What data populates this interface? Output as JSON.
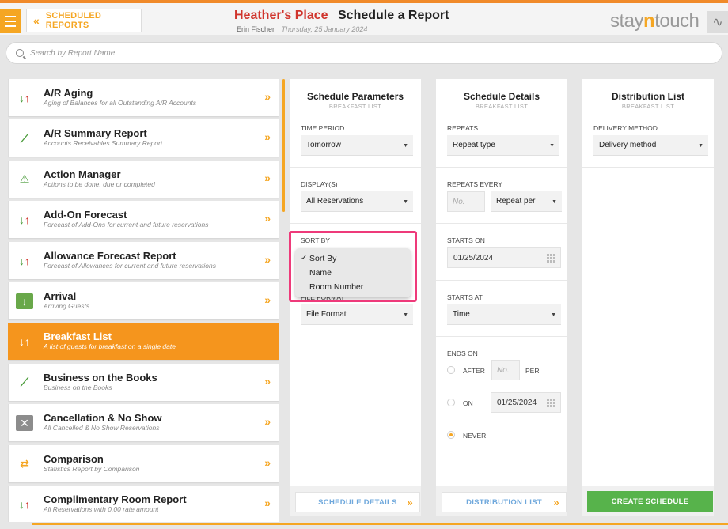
{
  "header": {
    "back_label": "SCHEDULED REPORTS",
    "hotel_name": "Heather's Place",
    "page_title": "Schedule a Report",
    "user": "Erin Fischer",
    "date": "Thursday, 25 January 2024",
    "logo_prefix": "stay",
    "logo_accent": "n",
    "logo_suffix": "touch"
  },
  "search": {
    "placeholder": "Search by Report Name"
  },
  "reports": [
    {
      "title": "A/R Aging",
      "desc": "Aging of Balances for all Outstanding A/R Accounts",
      "icon": "arrows-icon"
    },
    {
      "title": "A/R Summary Report",
      "desc": "Accounts Receivables Summary Report",
      "icon": "trend-icon"
    },
    {
      "title": "Action Manager",
      "desc": "Actions to be done, due or completed",
      "icon": "warning-icon"
    },
    {
      "title": "Add-On Forecast",
      "desc": "Forecast of Add-Ons for current and future reservations",
      "icon": "arrows-icon"
    },
    {
      "title": "Allowance Forecast Report",
      "desc": "Forecast of Allowances for current and future reservations",
      "icon": "arrows-icon"
    },
    {
      "title": "Arrival",
      "desc": "Arriving Guests",
      "icon": "arrival-icon"
    },
    {
      "title": "Breakfast List",
      "desc": "A list of guests for breakfast on a single date",
      "icon": "arrows-icon"
    },
    {
      "title": "Business on the Books",
      "desc": "Business on the Books",
      "icon": "trend-icon"
    },
    {
      "title": "Cancellation & No Show",
      "desc": "All Cancelled & No Show Reservations",
      "icon": "cancel-icon"
    },
    {
      "title": "Comparison",
      "desc": "Statistics Report by Comparison",
      "icon": "swap-icon"
    },
    {
      "title": "Complimentary Room Report",
      "desc": "All Reservations with 0.00 rate amount",
      "icon": "arrows-icon"
    }
  ],
  "params": {
    "title": "Schedule Parameters",
    "subtitle": "BREAKFAST LIST",
    "time_period_label": "TIME PERIOD",
    "time_period_value": "Tomorrow",
    "displays_label": "DISPLAY(S)",
    "displays_value": "All Reservations",
    "sort_by_label": "SORT BY",
    "sort_options": [
      "Sort By",
      "Name",
      "Room Number"
    ],
    "file_format_label": "FILE FORMAT",
    "file_format_value": "File Format",
    "next_button": "SCHEDULE DETAILS"
  },
  "details": {
    "title": "Schedule Details",
    "subtitle": "BREAKFAST LIST",
    "repeats_label": "REPEATS",
    "repeats_value": "Repeat type",
    "repeats_every_label": "REPEATS EVERY",
    "repeats_every_placeholder": "No.",
    "repeats_per_value": "Repeat per",
    "starts_on_label": "STARTS ON",
    "starts_on_value": "01/25/2024",
    "starts_at_label": "STARTS AT",
    "starts_at_value": "Time",
    "ends_on_label": "ENDS ON",
    "after_label": "AFTER",
    "after_placeholder": "No.",
    "per_label": "PER",
    "on_label": "ON",
    "on_value": "01/25/2024",
    "never_label": "NEVER",
    "next_button": "DISTRIBUTION LIST"
  },
  "distribution": {
    "title": "Distribution List",
    "subtitle": "BREAKFAST LIST",
    "delivery_label": "DELIVERY METHOD",
    "delivery_value": "Delivery method",
    "create_button": "CREATE SCHEDULE"
  },
  "colors": {
    "accent": "#f5a623",
    "hotel": "#d0342c",
    "create": "#57b34b",
    "highlight": "#ee3a7a"
  }
}
